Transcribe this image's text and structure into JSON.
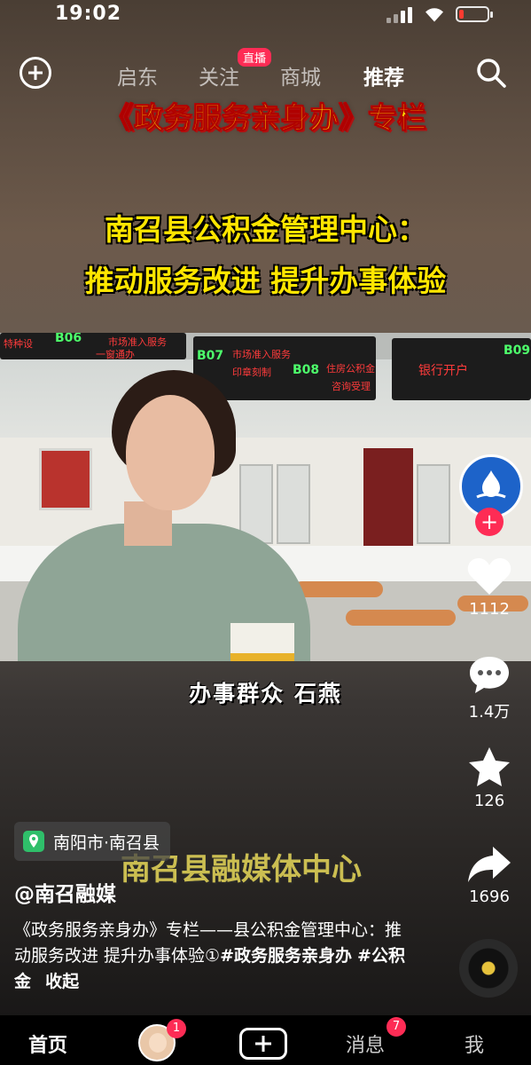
{
  "status": {
    "time": "19:02"
  },
  "topnav": {
    "tabs": [
      {
        "label": "启东"
      },
      {
        "label": "关注",
        "badge": "直播"
      },
      {
        "label": "商城"
      },
      {
        "label": "推荐",
        "active": true
      }
    ]
  },
  "video": {
    "title": "《政务服务亲身办》专栏",
    "headline_1": "南召县公积金管理中心：",
    "headline_2": "推动服务改进  提升办事体验",
    "scene_signs": [
      "B06",
      "B07",
      "B08",
      "B09",
      "市场准入服务",
      "住房公积金",
      "银行开户",
      "一窗通办",
      "印章刻制",
      "咨询受理",
      "特种设"
    ],
    "speaker_caption": "办事群众   石燕",
    "watermark": "南召县融媒体中心"
  },
  "rail": {
    "likes": "1112",
    "comments": "1.4万",
    "favorites": "126",
    "shares": "1696",
    "avatar_text": "南召县融媒体中心"
  },
  "post": {
    "location": "南阳市·南召县",
    "author": "@南召融媒",
    "desc_text": "《政务服务亲身办》专栏——县公积金管理中心：推动服务改进 提升办事体验①",
    "tag1": "#政务服务亲身办",
    "tag2": "#公积金",
    "collapse": "收起"
  },
  "bottombar": {
    "home": "首页",
    "friends_badge": "1",
    "messages": "消息",
    "messages_badge": "7",
    "me": "我"
  },
  "colors": {
    "accent": "#fe2c55",
    "title_yellow": "#ffe600",
    "location_green": "#2fbf6a"
  }
}
